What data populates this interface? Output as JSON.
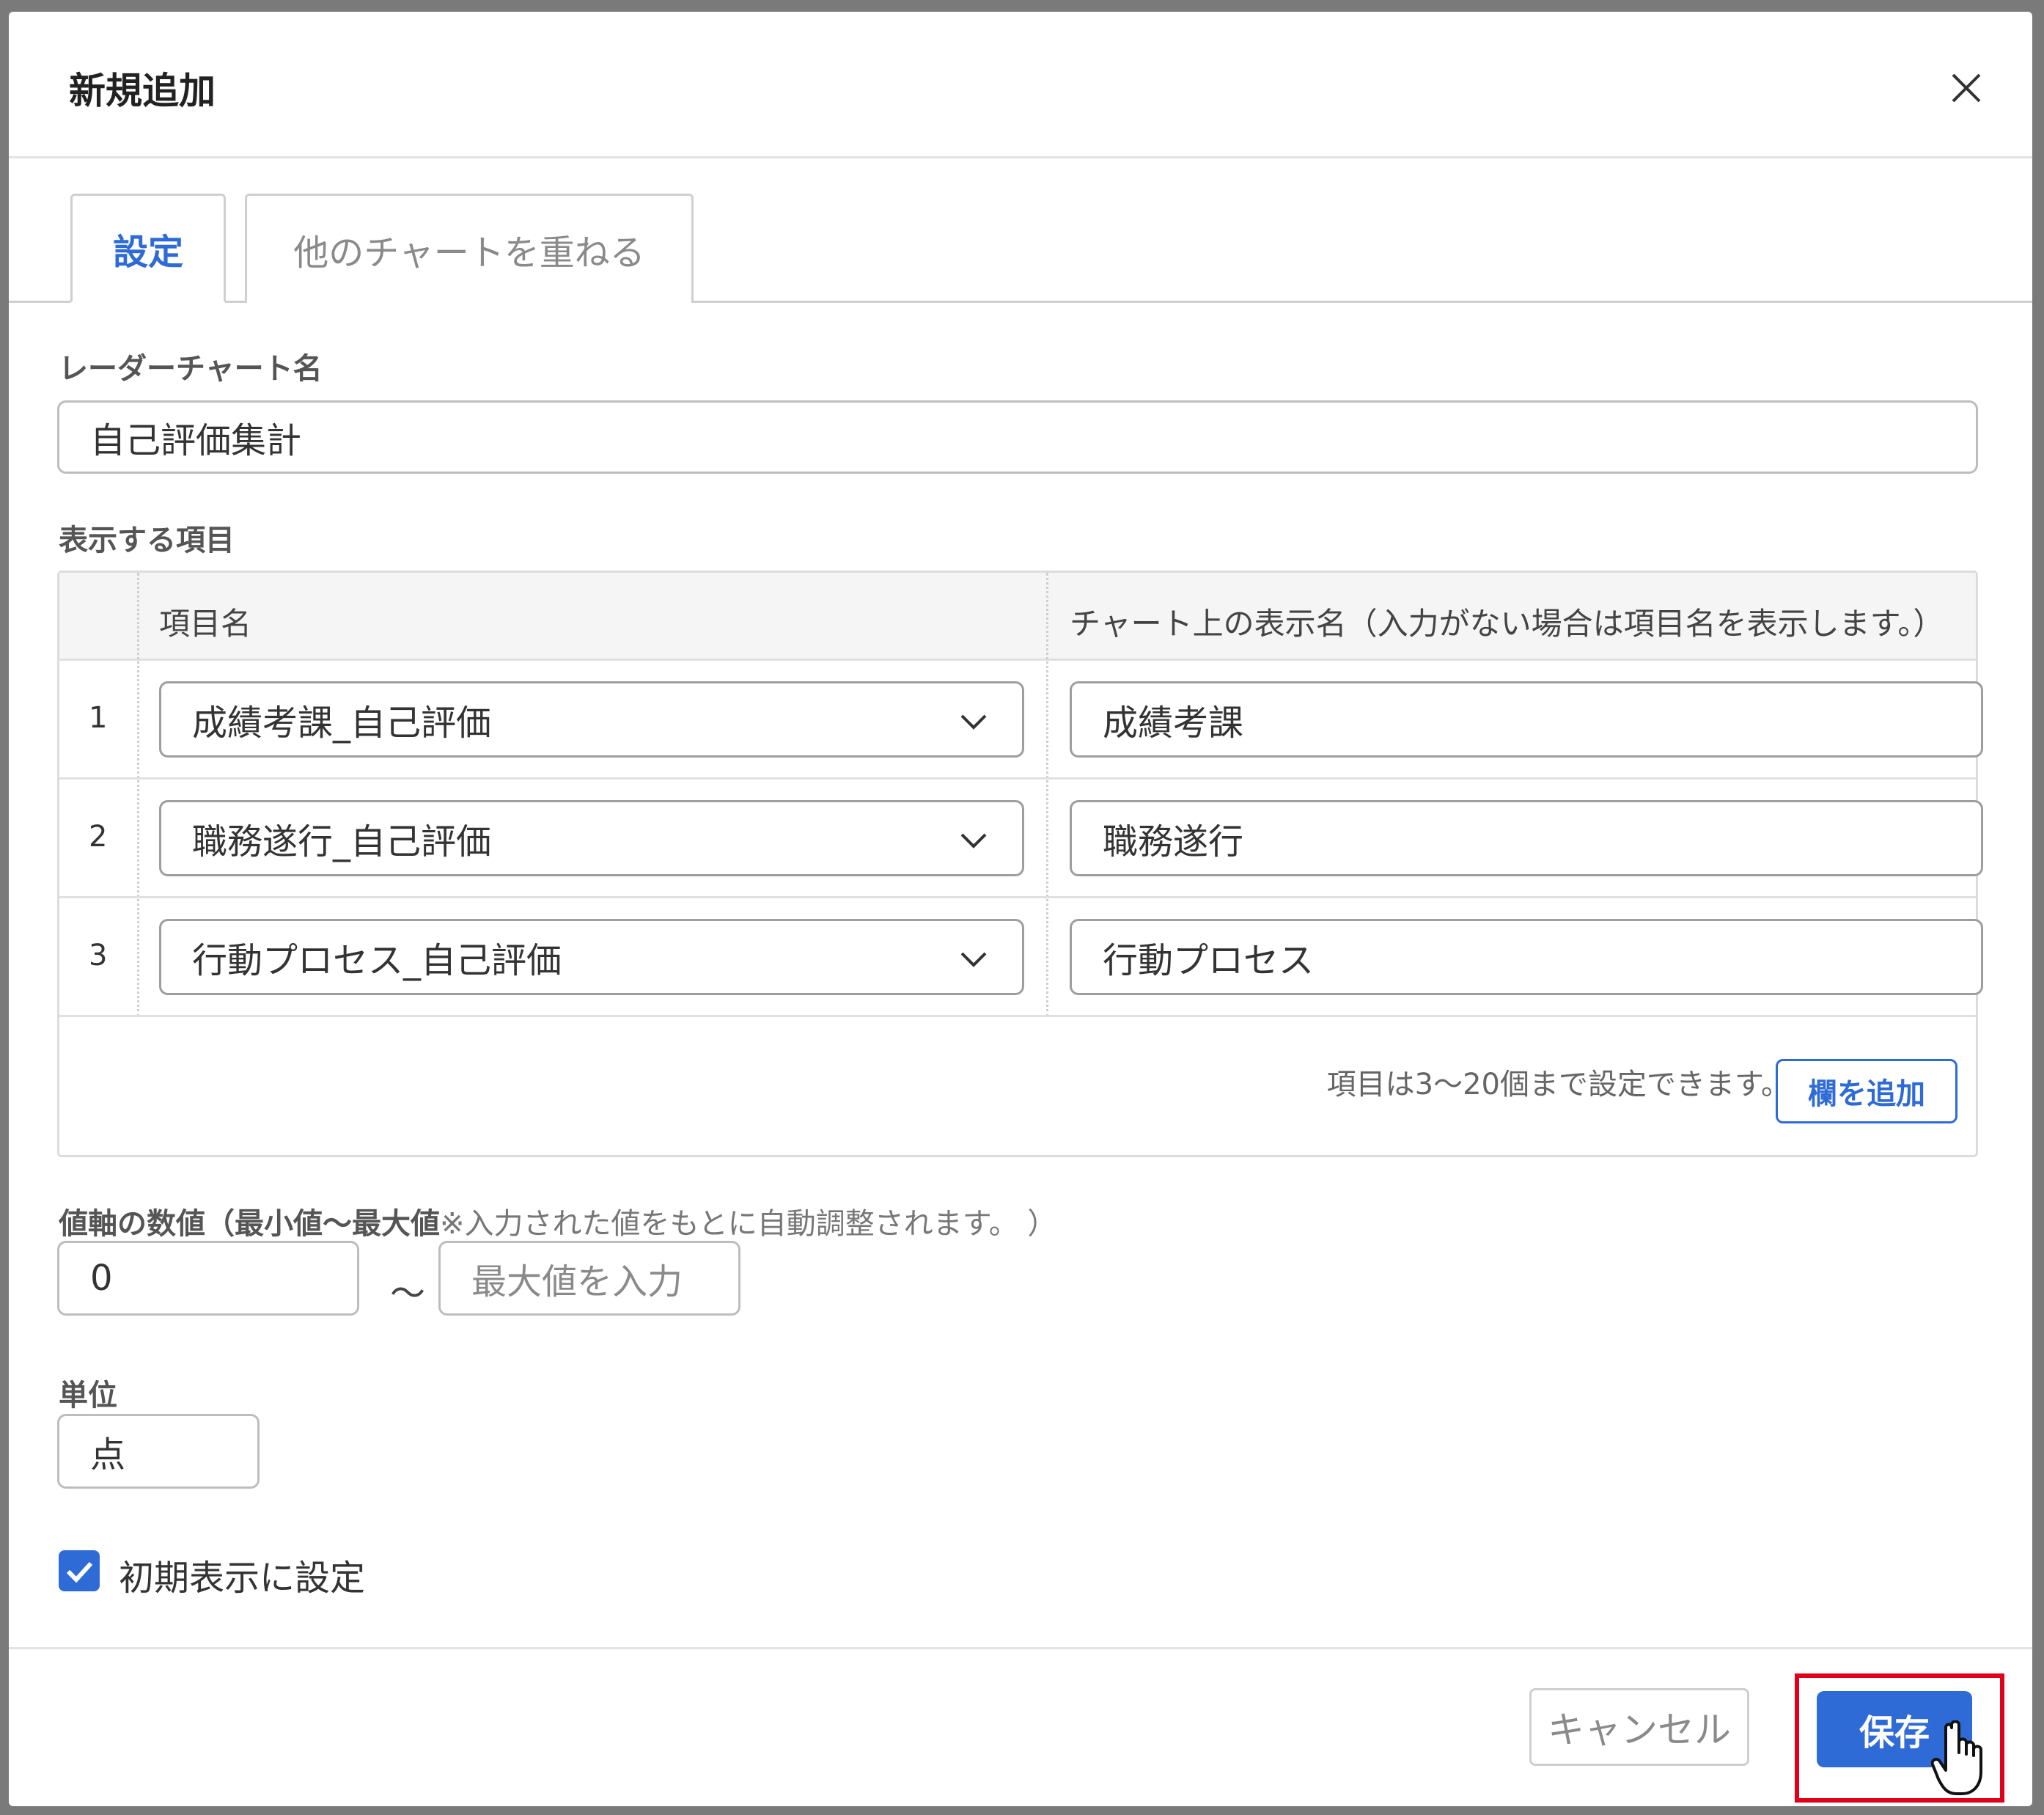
{
  "dialog": {
    "title": "新規追加",
    "close_icon": "close-icon"
  },
  "tabs": [
    {
      "label": "設定",
      "active": true
    },
    {
      "label": "他のチャートを重ねる",
      "active": false
    }
  ],
  "chart_name": {
    "label": "レーダーチャート名",
    "value": "自己評価集計"
  },
  "items": {
    "label": "表示する項目",
    "columns": [
      "項目名",
      "チャート上の表示名（入力がない場合は項目名を表示します。）"
    ],
    "rows": [
      {
        "num": "1",
        "item": "成績考課_自己評価",
        "display": "成績考課"
      },
      {
        "num": "2",
        "item": "職務遂行_自己評価",
        "display": "職務遂行"
      },
      {
        "num": "3",
        "item": "行動プロセス_自己評価",
        "display": "行動プロセス"
      }
    ],
    "note": "項目は3〜20個まで設定できます。",
    "add_button": "欄を追加"
  },
  "axis": {
    "label_bold": "値軸の数値（最小値〜最大値",
    "label_note": "※入力された値をもとに自動調整されます。 ）",
    "min_value": "0",
    "separator": "〜",
    "max_placeholder": "最大値を入力"
  },
  "unit": {
    "label": "単位",
    "value": "点"
  },
  "default_display": {
    "label": "初期表示に設定",
    "checked": true
  },
  "footer": {
    "cancel": "キャンセル",
    "save": "保存"
  },
  "colors": {
    "accent": "#2e6bd6",
    "highlight": "#e1001a"
  }
}
